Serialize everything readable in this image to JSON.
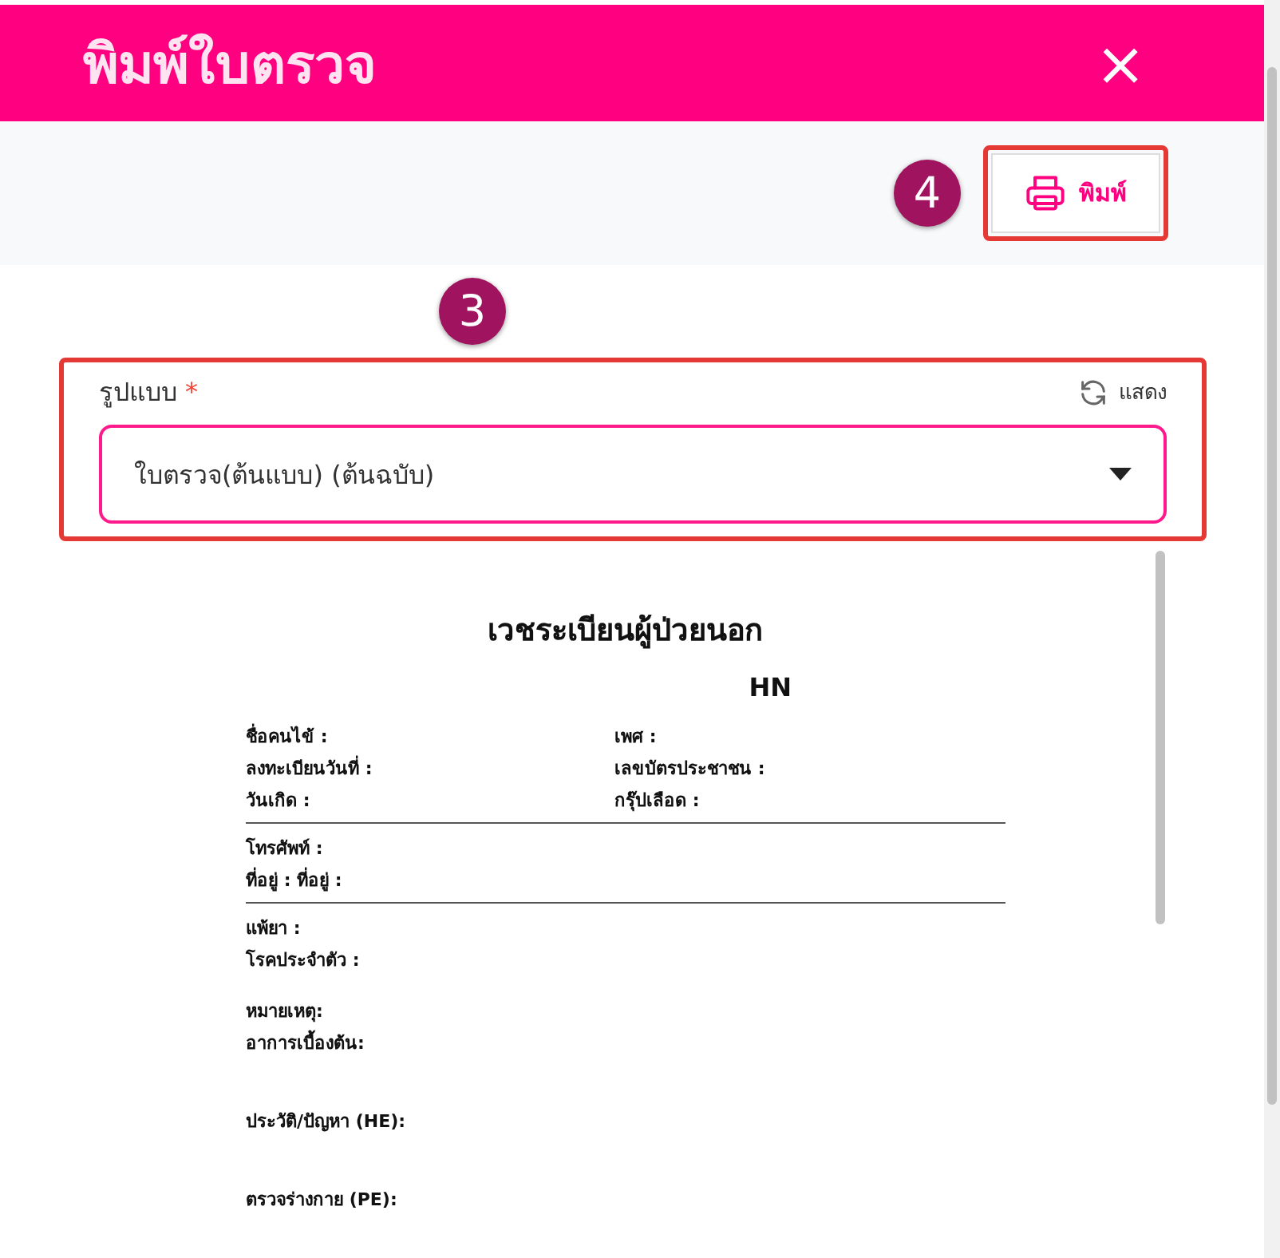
{
  "header": {
    "title": "พิมพ์ใบตรวจ",
    "close": "×"
  },
  "toolbar": {
    "callout": "4",
    "print_button": {
      "label": "พิมพ์"
    }
  },
  "form": {
    "callout": "3",
    "label": "รูปแบบ",
    "required": "*",
    "refresh": "แสดง",
    "select": {
      "value": "ใบตรวจ(ต้นแบบ) (ต้นฉบับ)"
    }
  },
  "document": {
    "title": "เวชระเบียนผู้ป่วยนอก",
    "hn": "HN",
    "blocks": [
      {
        "kind": "pairs",
        "rows": [
          {
            "left": "ชื่อคนไข้ :",
            "right": "เพศ :"
          },
          {
            "left": "ลงทะเบียนวันที่ :",
            "right": "เลขบัตรประชาชน :"
          },
          {
            "left": "วันเกิด :",
            "right": "กรุ๊ปเลือด :"
          }
        ]
      },
      {
        "kind": "rule"
      },
      {
        "kind": "lines",
        "lines": [
          "โทรศัพท์ :",
          "ที่อยู่ : ที่อยู่ :"
        ]
      },
      {
        "kind": "rule"
      },
      {
        "kind": "lines",
        "lines": [
          "แพ้ยา :",
          "โรคประจำตัว :"
        ]
      },
      {
        "kind": "space"
      },
      {
        "kind": "lines",
        "lines": [
          "หมายเหตุ:",
          "อาการเบื้องต้น:"
        ]
      },
      {
        "kind": "space"
      },
      {
        "kind": "space"
      },
      {
        "kind": "lines",
        "lines": [
          "ประวัติ/ปัญหา (HE):"
        ]
      },
      {
        "kind": "space"
      },
      {
        "kind": "space"
      },
      {
        "kind": "lines",
        "lines": [
          "ตรวจร่างกาย (PE):"
        ]
      }
    ]
  }
}
